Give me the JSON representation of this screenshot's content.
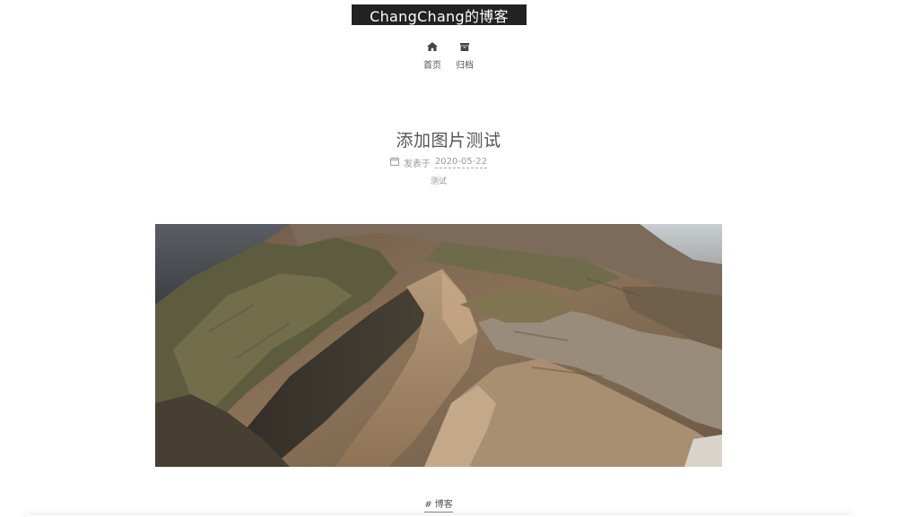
{
  "site": {
    "title": "ChangChang的博客"
  },
  "nav": {
    "items": [
      {
        "label": "首页",
        "icon": "home-icon"
      },
      {
        "label": "归档",
        "icon": "archive-icon"
      }
    ]
  },
  "post": {
    "title": "添加图片测试",
    "meta_prefix": "发表于",
    "date": "2020-05-22",
    "category": "测试",
    "tag": "# 博客"
  },
  "colors": {
    "header_bg": "#222222",
    "text": "#555555",
    "meta": "#999999"
  }
}
